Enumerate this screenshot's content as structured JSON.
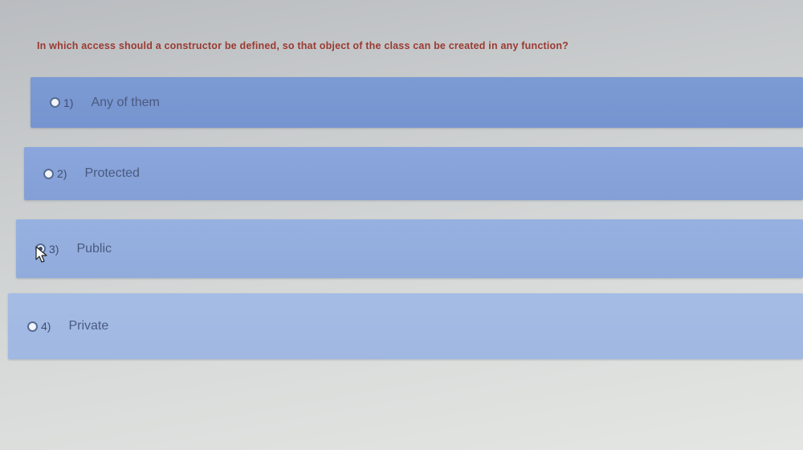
{
  "question": {
    "text": "In which access should a constructor be defined, so that object of the class can be created in any function?"
  },
  "options": [
    {
      "number": "1)",
      "label": "Any of them",
      "selected": false
    },
    {
      "number": "2)",
      "label": "Protected",
      "selected": false
    },
    {
      "number": "3)",
      "label": "Public",
      "selected": true
    },
    {
      "number": "4)",
      "label": "Private",
      "selected": false
    }
  ],
  "colors": {
    "question_text": "#9a3a32",
    "option_background": "#7c9ad3",
    "option_text": "#4a5a80",
    "page_background": "#d6d9d8"
  },
  "icons": {
    "radio": "radio-button-icon",
    "cursor": "mouse-pointer-icon"
  }
}
